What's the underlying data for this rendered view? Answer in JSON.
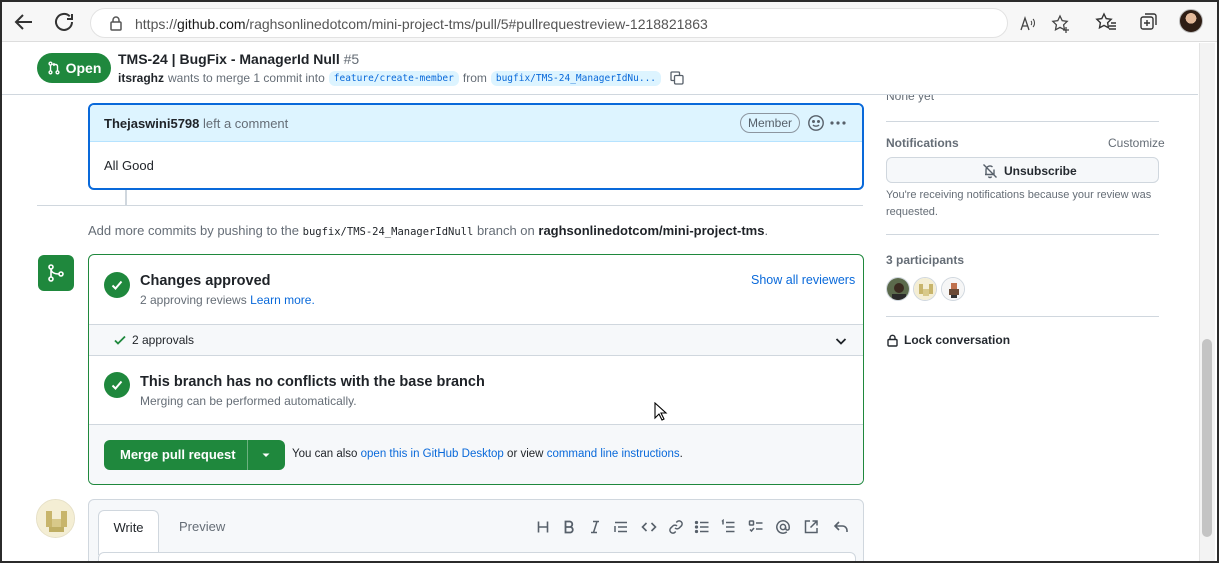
{
  "browser": {
    "url_prefix": "https://",
    "url_host": "github.com",
    "url_path": "/raghsonlinedotcom/mini-project-tms/pull/5#pullrequestreview-1218821863",
    "icons": [
      "back-icon",
      "refresh-icon",
      "lock-icon",
      "read-aloud-icon",
      "add-favorite-icon",
      "favorites-icon",
      "collections-icon",
      "profile-avatar"
    ]
  },
  "header": {
    "state_label": "Open",
    "title": "TMS-24 | BugFix - ManagerId Null",
    "number": "#5",
    "author": "itsraghz",
    "meta_text": "wants to merge 1 commit into",
    "base_branch": "feature/create-member",
    "from_text": "from",
    "head_branch": "bugfix/TMS-24_ManagerIdNu..."
  },
  "comment": {
    "author": "Thejaswini5798",
    "action": "left a comment",
    "badge": "Member",
    "body": "All Good"
  },
  "timeline": {
    "add_commits_prefix": "Add more commits by pushing to the",
    "branch": "bugfix/TMS-24_ManagerIdNull",
    "branch_on": "branch on",
    "repo": "raghsonlinedotcom/mini-project-tms",
    "period": "."
  },
  "merge": {
    "approved_title": "Changes approved",
    "approved_sub": "2 approving reviews",
    "learn_more": "Learn more.",
    "show_reviewers": "Show all reviewers",
    "approvals_label": "2 approvals",
    "conflict_title": "This branch has no conflicts with the base branch",
    "conflict_sub": "Merging can be performed automatically.",
    "merge_button": "Merge pull request",
    "alt_prefix": "You can also",
    "alt_link1": "open this in GitHub Desktop",
    "alt_mid": "or view",
    "alt_link2": "command line instructions",
    "alt_suffix": "."
  },
  "editor": {
    "tab_write": "Write",
    "tab_preview": "Preview",
    "toolbar_icons": [
      "heading-icon",
      "bold-icon",
      "italic-icon",
      "quote-icon",
      "code-icon",
      "link-icon",
      "unordered-list-icon",
      "ordered-list-icon",
      "task-list-icon",
      "mention-icon",
      "reference-icon",
      "reply-icon"
    ]
  },
  "sidebar": {
    "cut_text": "None yet",
    "notifications_label": "Notifications",
    "customize": "Customize",
    "unsubscribe": "Unsubscribe",
    "notify_note": "You're receiving notifications because your review was requested.",
    "participants_label": "3 participants",
    "lock_label": "Lock conversation"
  },
  "colors": {
    "green": "#1f883d",
    "blue": "#0969da",
    "comment_header": "#ddf4ff"
  }
}
